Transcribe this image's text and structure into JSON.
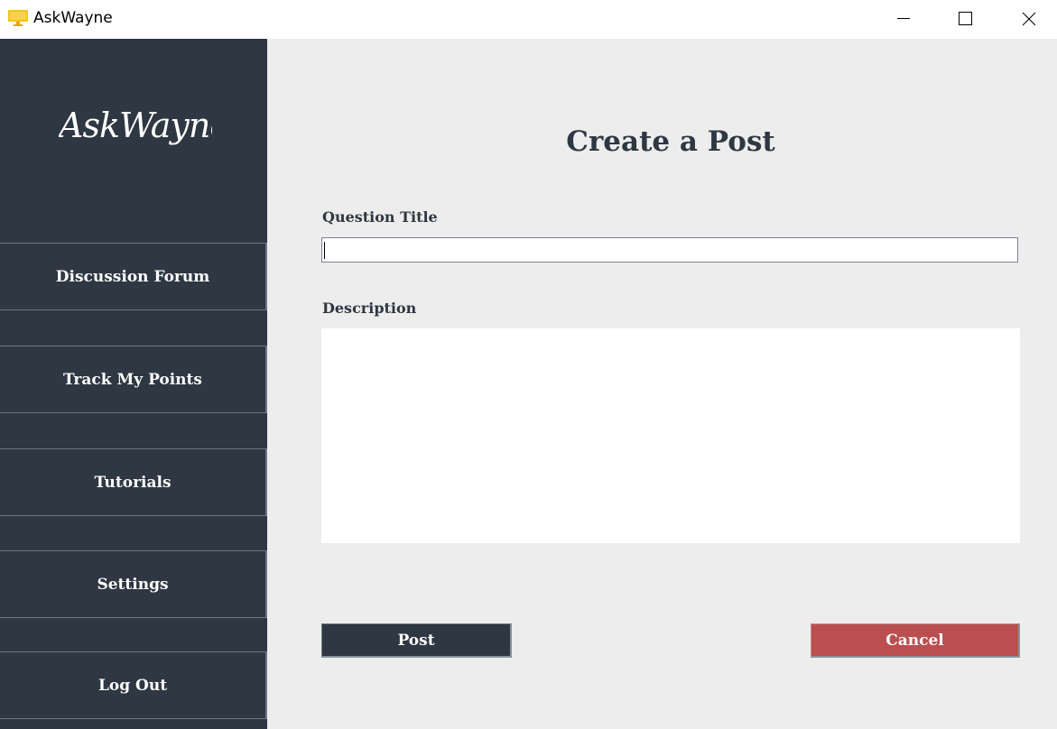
{
  "window": {
    "title": "AskWayne",
    "icon": "monitor-icon",
    "controls": [
      "minimize-icon",
      "maximize-icon",
      "close-icon"
    ]
  },
  "sidebar": {
    "brand": "AskWayne",
    "items": [
      {
        "label": "Discussion Forum"
      },
      {
        "label": "Track My Points"
      },
      {
        "label": "Tutorials"
      },
      {
        "label": "Settings"
      },
      {
        "label": "Log Out"
      }
    ]
  },
  "main": {
    "title": "Create a Post",
    "question_title_label": "Question Title",
    "question_title_value": "",
    "description_label": "Description",
    "description_value": "",
    "post_label": "Post",
    "cancel_label": "Cancel"
  },
  "colors": {
    "sidebar_bg": "#2e3742",
    "main_bg": "#ededed",
    "cancel_bg": "#bb4f4f",
    "icon_accent": "#f5c518"
  }
}
